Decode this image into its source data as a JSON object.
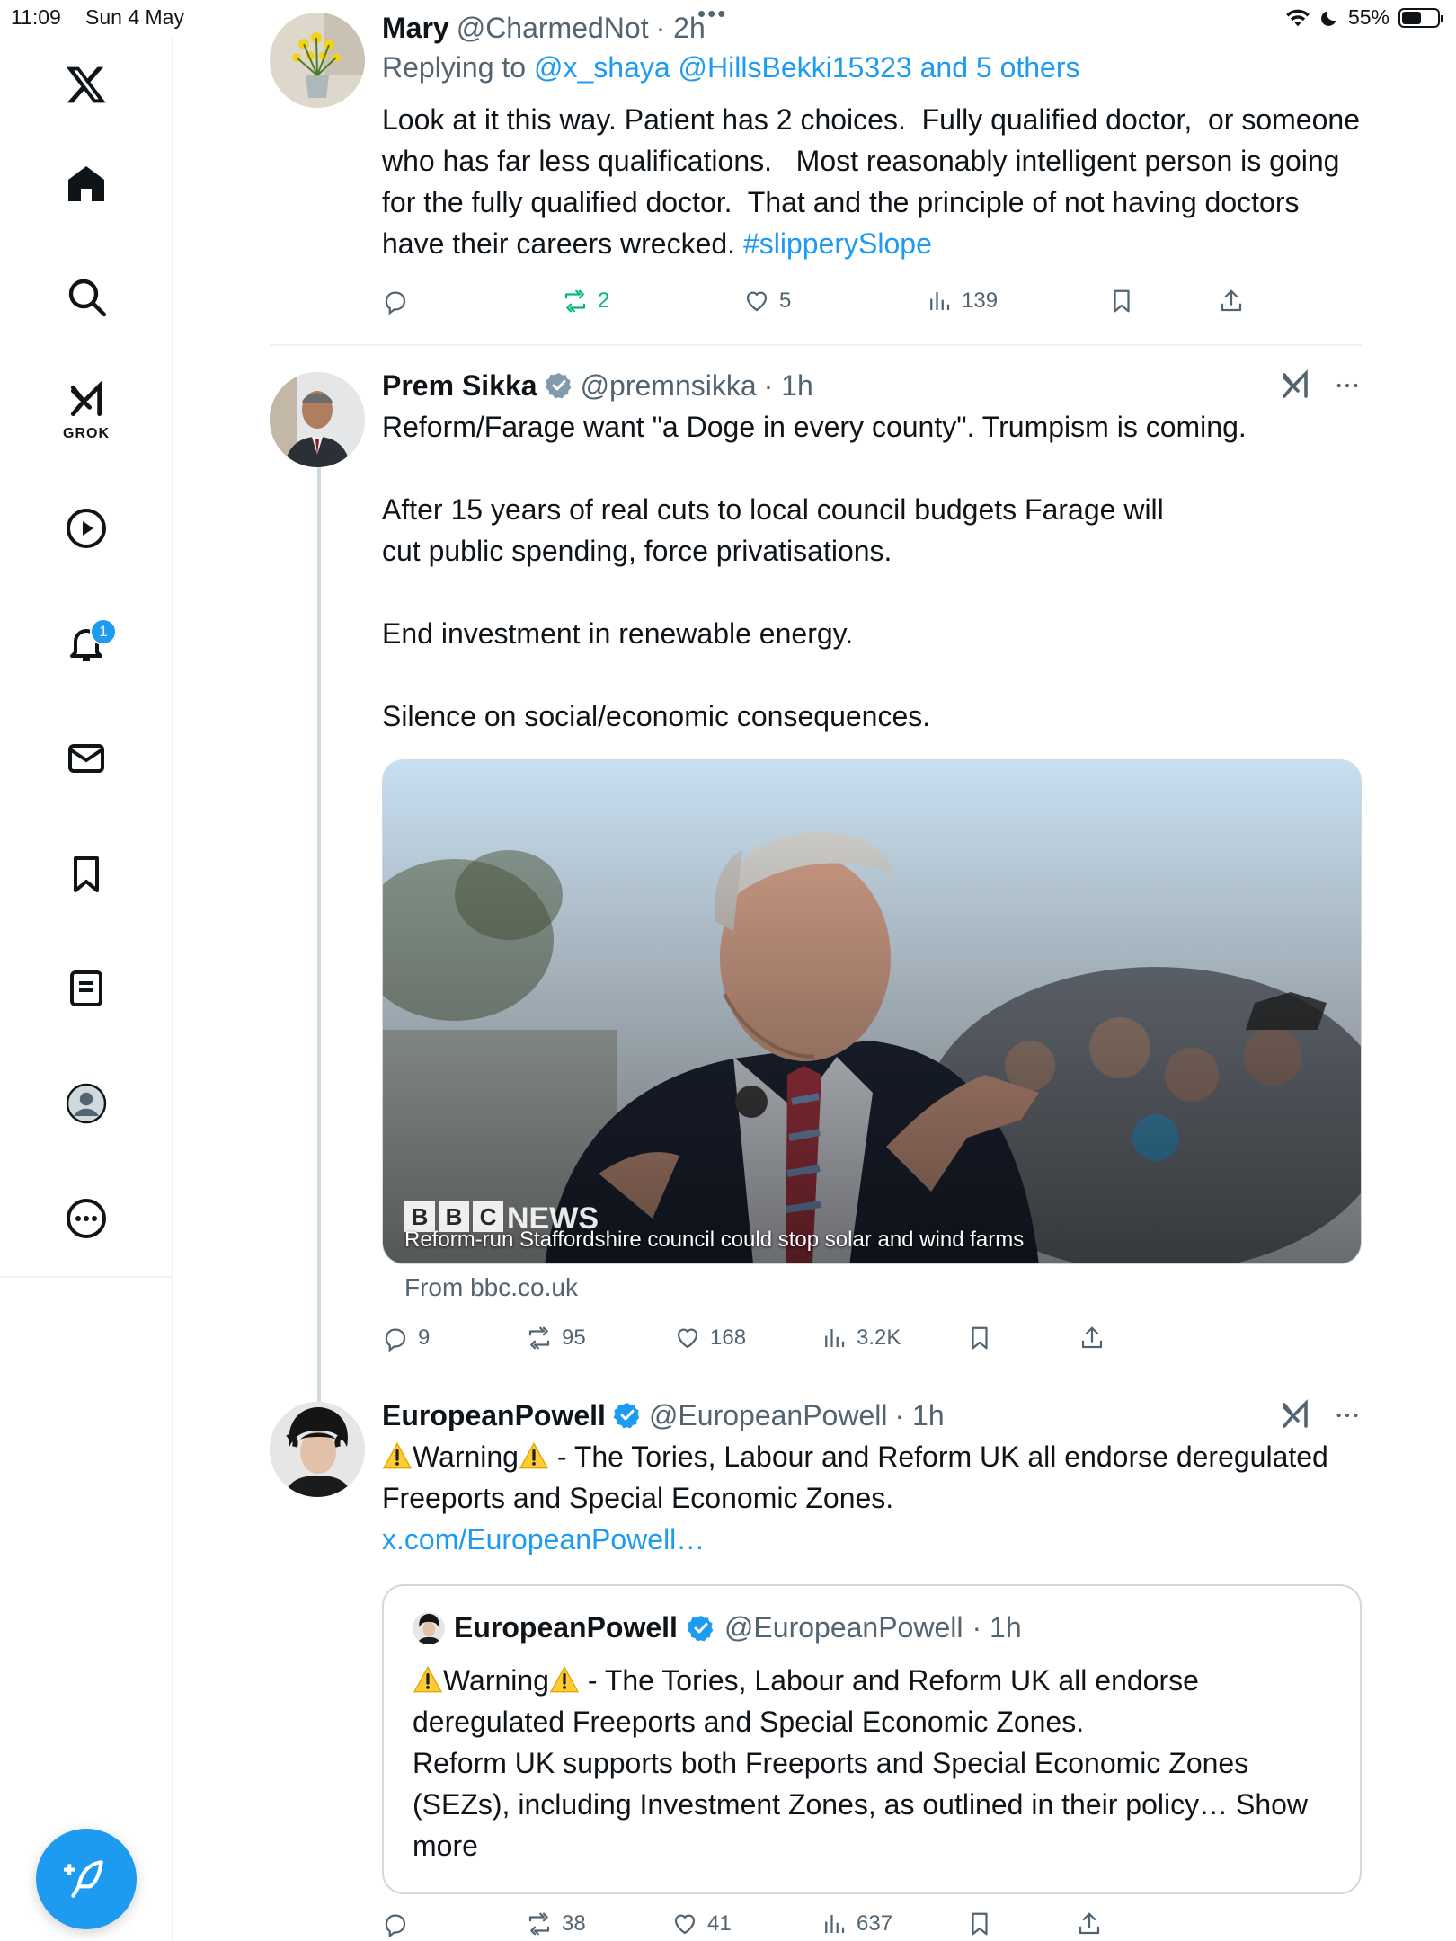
{
  "status_bar": {
    "time": "11:09",
    "date": "Sun 4 May",
    "battery": "55%",
    "battery_level": 0.55
  },
  "sidebar": {
    "grok_label": "GROK",
    "notification_count": "1"
  },
  "tweets": [
    {
      "name": "Mary",
      "handle": "@CharmedNot",
      "time": "· 2h",
      "replying_prefix": "Replying to",
      "replying_to": "@x_shaya @HillsBekki15323 and 5 others",
      "text": "Look at it this way. Patient has 2 choices.  Fully qualified doctor,  or someone who has far less qualifications.   Most reasonably intelligent person is going for the fully qualified doctor.  That and the principle of not having doctors have their careers wrecked. ",
      "hashtag": "#slipperySlope",
      "replies": "",
      "retweets": "2",
      "likes": "5",
      "views": "139"
    },
    {
      "name": "Prem Sikka",
      "handle": "@premnsikka",
      "time": "· 1h",
      "text": "Reform/Farage want \"a Doge in every county\". Trumpism is coming.\n\nAfter 15 years of real cuts to local council budgets Farage will\ncut public spending, force privatisations.\n\nEnd investment in renewable energy.\n\nSilence on social/economic consequences.",
      "media_caption": "Reform-run Staffordshire council could stop solar and wind farms",
      "media_brand": "NEWS",
      "from_link": "From bbc.co.uk",
      "replies": "9",
      "retweets": "95",
      "likes": "168",
      "views": "3.2K"
    },
    {
      "name": "EuropeanPowell",
      "handle": "@EuropeanPowell",
      "time": "· 1h",
      "warning_word": "Warning",
      "text_after_warning": " - The Tories, Labour and Reform UK all endorse deregulated Freeports and Special Economic Zones.",
      "link": "x.com/EuropeanPowell…",
      "quote": {
        "name": "EuropeanPowell",
        "handle": "@EuropeanPowell",
        "time": "· 1h",
        "warning_word": "Warning",
        "text_after_warning": " - The Tories, Labour and Reform UK all endorse deregulated Freeports and Special Economic Zones.\nReform UK supports both Freeports and Special Economic Zones (SEZs), including Investment Zones, as outlined in their policy… ",
        "show_more": "Show more"
      },
      "replies": "",
      "retweets": "38",
      "likes": "41",
      "views": "637"
    }
  ],
  "colors": {
    "accent": "#1d9bf0",
    "retweet_active": "#00ba7c",
    "muted": "#536471",
    "border": "#eff3f4"
  }
}
